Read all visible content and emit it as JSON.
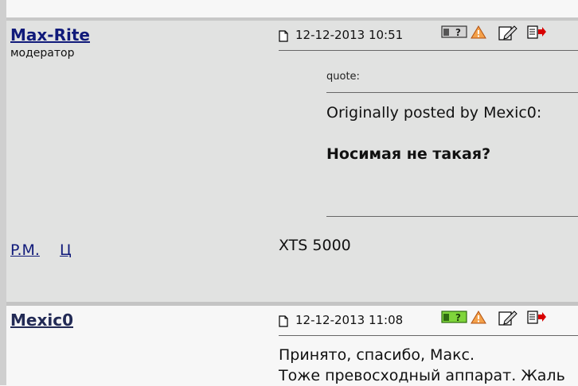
{
  "posts": [
    {
      "author": "Max-Rite",
      "role": "модератор",
      "datetime": "12-12-2013 10:51",
      "quote": {
        "label": "quote:",
        "origin": "Originally posted by Mexic0:",
        "text": "Носимая не такая?"
      },
      "message": "XTS 5000",
      "links": [
        "P.M.",
        "Ц"
      ],
      "icons": [
        "user-status-icon",
        "report-icon",
        "edit-icon",
        "reply-icon"
      ],
      "colors": {
        "background": "#e1e2e1",
        "author": "#101a7a"
      }
    },
    {
      "author": "Mexic0",
      "datetime": "12-12-2013 11:08",
      "message_lines": [
        "Принято, спасибо, Макс.",
        "Тоже превосходный аппарат. Жаль"
      ],
      "icons": [
        "user-online-icon",
        "report-icon",
        "edit-icon",
        "reply-icon"
      ],
      "colors": {
        "background": "#f7f7f7",
        "online_badge": "#7fd53b"
      }
    }
  ]
}
